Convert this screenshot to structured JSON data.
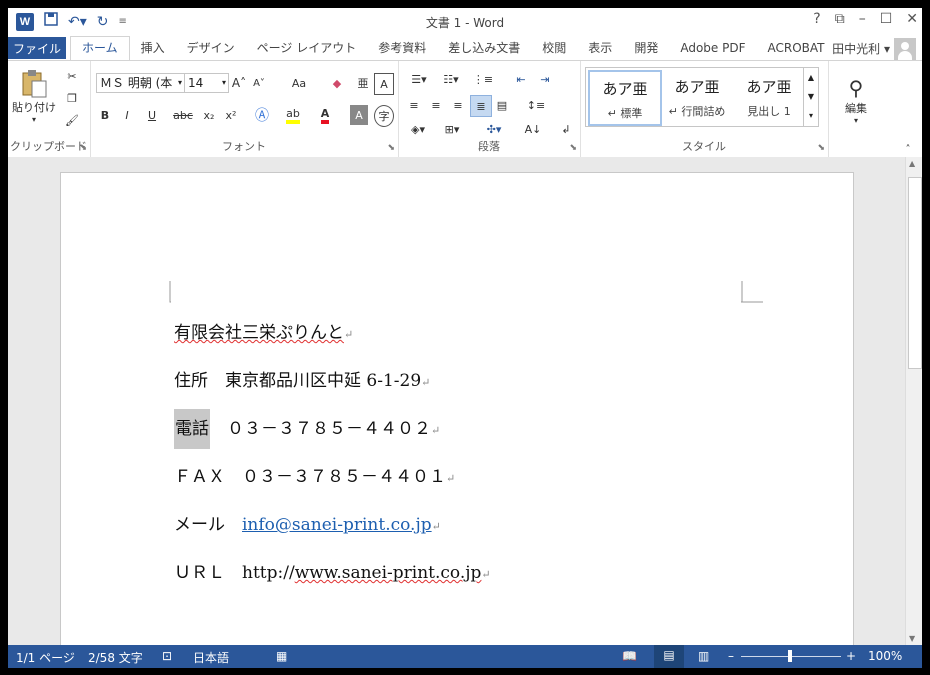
{
  "window": {
    "title": "文書 1 - Word",
    "controls": [
      "?",
      "⧉",
      "–",
      "☐",
      "✕"
    ]
  },
  "qat": {
    "logo": "W",
    "save_icon": "save-icon",
    "undo_icon": "undo-icon",
    "redo_icon": "redo-icon"
  },
  "tabs": {
    "file": "ファイル",
    "items": [
      "ホーム",
      "挿入",
      "デザイン",
      "ページ レイアウト",
      "参考資料",
      "差し込み文書",
      "校閲",
      "表示",
      "開発",
      "Adobe PDF",
      "ACROBAT"
    ],
    "active": "ホーム"
  },
  "user": {
    "name": "田中光利 ▾"
  },
  "ribbon": {
    "clipboard": {
      "paste": "貼り付け",
      "label": "クリップボード"
    },
    "font": {
      "name": "ＭＳ 明朝 (本",
      "size": "14",
      "label": "フォント",
      "bold": "B",
      "italic": "I",
      "underline": "U",
      "strike": "abc",
      "subscript": "x₂",
      "superscript": "x²",
      "grow": "A˄",
      "shrink": "A˅",
      "case": "Aa",
      "color_accent": "#e81123",
      "highlight": "#ffff00"
    },
    "paragraph": {
      "label": "段落"
    },
    "styles": {
      "label": "スタイル",
      "items": [
        {
          "sample": "あア亜",
          "name": "↵ 標準"
        },
        {
          "sample": "あア亜",
          "name": "↵ 行間詰め"
        },
        {
          "sample": "あア亜",
          "name": "見出し 1"
        }
      ]
    },
    "editing": {
      "label": "編集"
    }
  },
  "document": {
    "lines": [
      {
        "text": "有限会社三栄ぷりんと",
        "mark": "↵"
      },
      {
        "text": "住所　東京都品川区中延 6‐1‐29",
        "mark": "↵"
      },
      {
        "prefix": "電話",
        "text": "　０３－３７８５－４４０２",
        "mark": "↵"
      },
      {
        "text": "ＦＡＸ　０３－３７８５－４４０１",
        "mark": "↵"
      },
      {
        "prefix": "メール　",
        "link": "info@sanei-print.co.jp",
        "mark": "↵"
      },
      {
        "prefix": "ＵＲＬ　http://",
        "text": "www.sanei-print.co.jp",
        "mark": "↵"
      }
    ]
  },
  "statusbar": {
    "page": "1/1 ページ",
    "words": "2/58 文字",
    "lang": "日本語",
    "zoom": "100%",
    "zoom_minus": "–",
    "zoom_plus": "+"
  },
  "colors": {
    "brand": "#2b579a",
    "link": "#1d5fb0"
  }
}
